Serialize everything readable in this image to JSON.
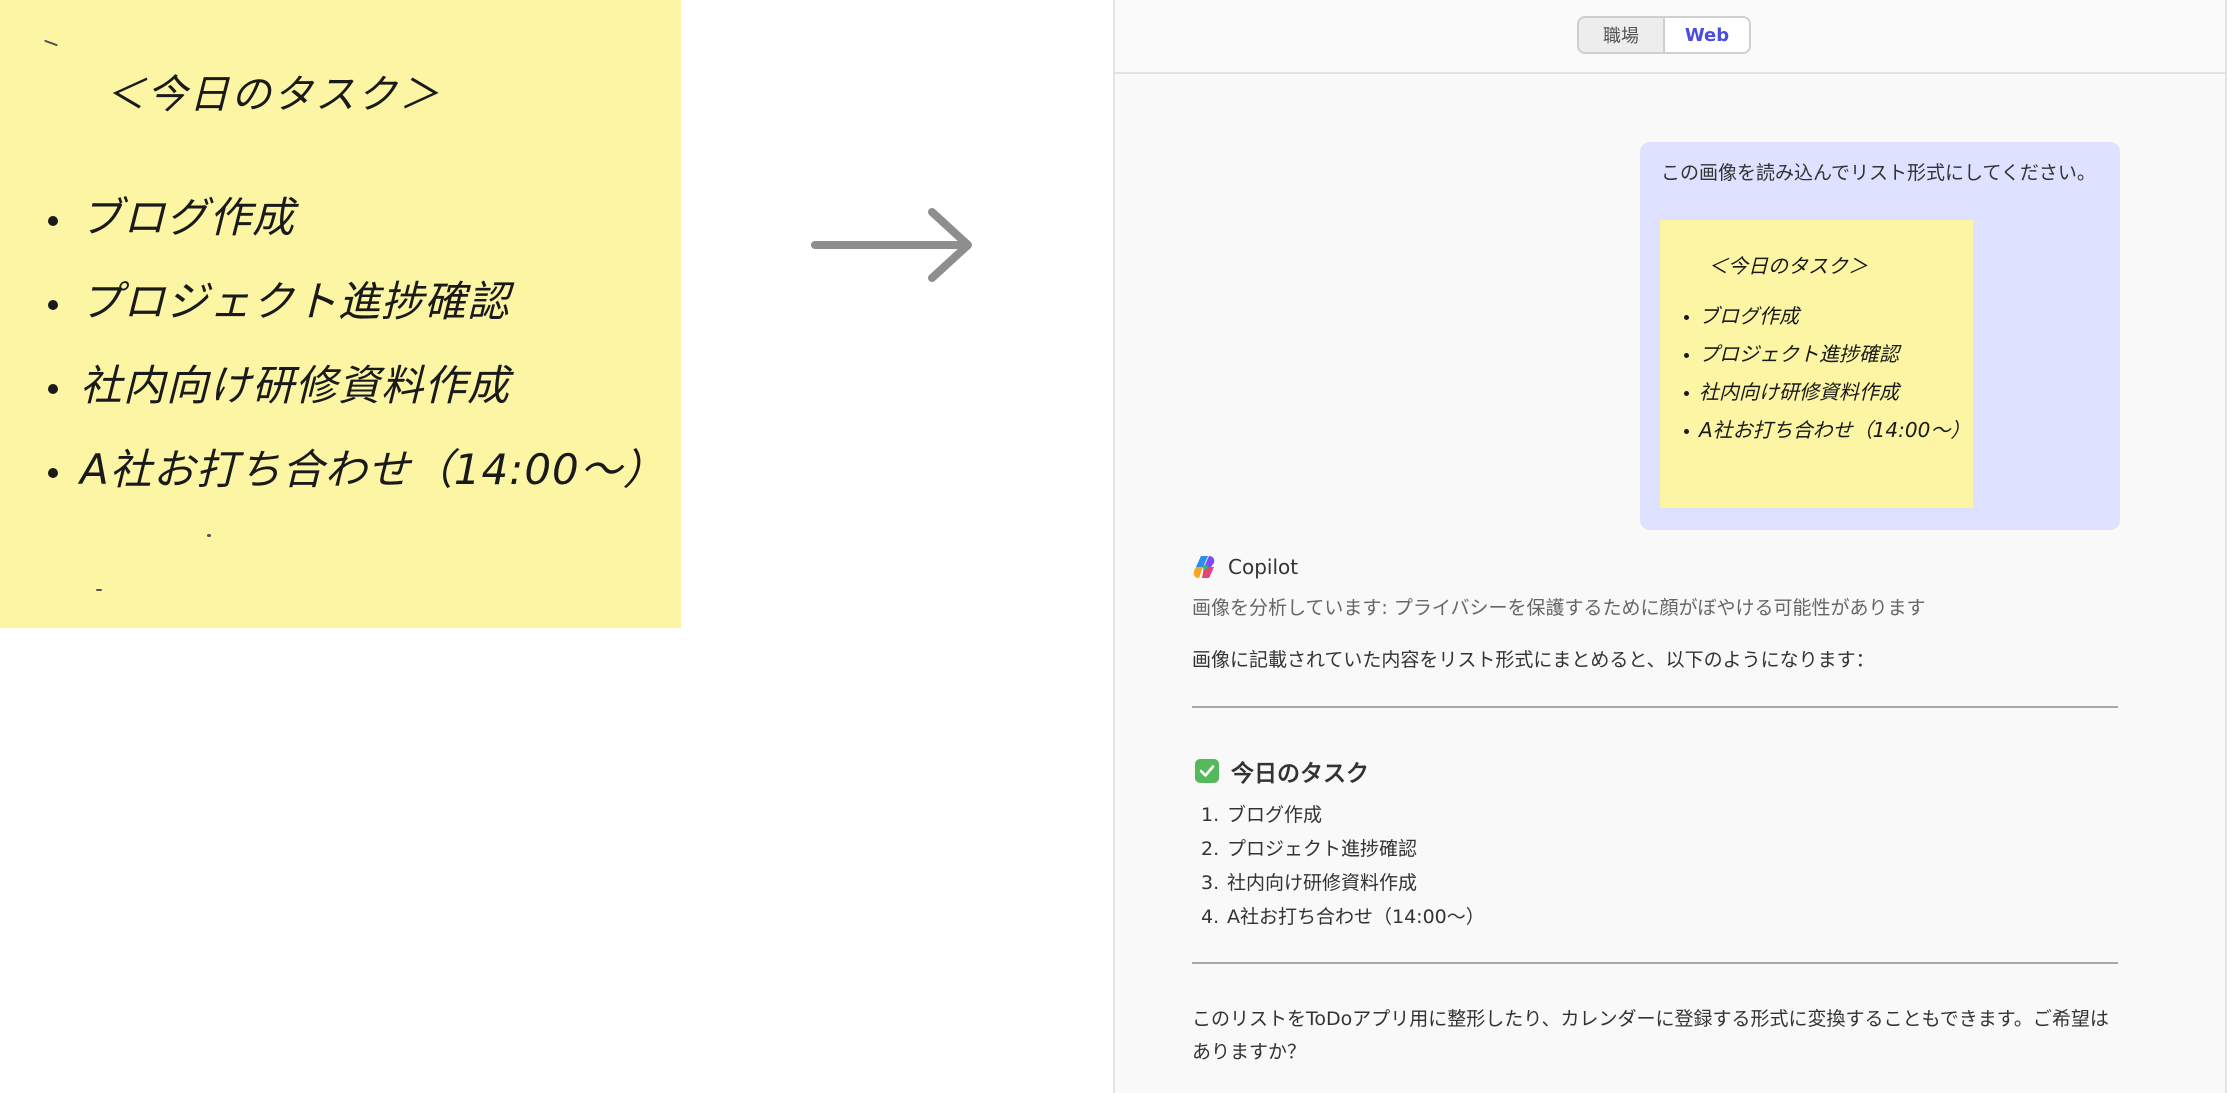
{
  "sticky_note": {
    "title": "＜今日のタスク＞",
    "items": [
      "ブログ作成",
      "プロジェクト進捗確認",
      "社内向け研修資料作成",
      "A社お打ち合わせ（14:00〜）"
    ]
  },
  "header": {
    "toggle": {
      "work_label": "職場",
      "web_label": "Web",
      "selected": "Web"
    }
  },
  "user_message": {
    "text": "この画像を読み込んでリスト形式にしてください。"
  },
  "assistant": {
    "name": "Copilot",
    "analyzing": "画像を分析しています: プライバシーを保護するために顔がぼやける可能性があります",
    "intro": "画像に記載されていた内容をリスト形式にまとめると、以下のようになります：",
    "task_heading": "今日のタスク",
    "tasks": [
      {
        "num": "1.",
        "text": "ブログ作成"
      },
      {
        "num": "2.",
        "text": "プロジェクト進捗確認"
      },
      {
        "num": "3.",
        "text": "社内向け研修資料作成"
      },
      {
        "num": "4.",
        "text": "A社お打ち合わせ（14:00〜）"
      }
    ],
    "followup": "このリストをToDoアプリ用に整形したり、カレンダーに登録する形式に変換することもできます。ご希望はありますか？"
  },
  "colors": {
    "sticky_yellow": "#fbf5a4",
    "user_bubble": "#dee1ff",
    "accent_blue": "#4a4de0",
    "check_green": "#55b85a"
  },
  "icons": [
    "arrow-right-icon",
    "copilot-logo-icon",
    "check-box-icon"
  ]
}
